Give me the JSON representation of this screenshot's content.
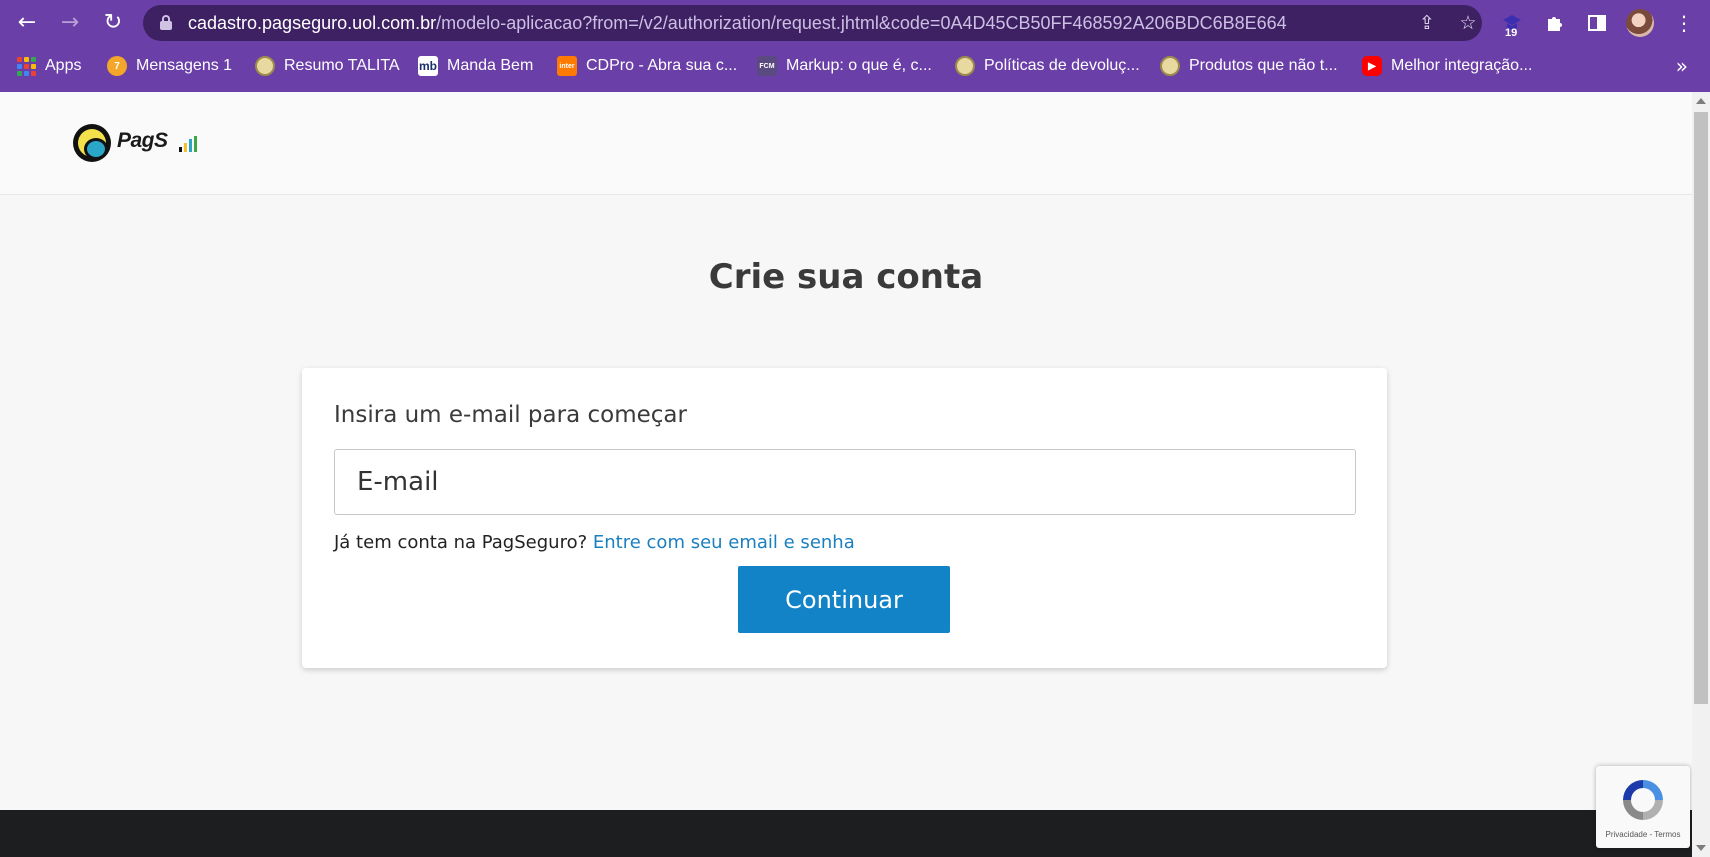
{
  "browser": {
    "url_host": "cadastro.pagseguro.uol.com.br",
    "url_path": "/modelo-aplicacao?from=/v2/authorization/request.jhtml&code=0A4D45CB50FF468592A206BDC6B8E664",
    "extension_badge": "19",
    "bookmarks": [
      {
        "label": "Apps",
        "icon": "apps-grid-icon"
      },
      {
        "label": "Mensagens 1",
        "icon": "message-icon",
        "icon_text": "7",
        "color": "#f4a62a"
      },
      {
        "label": "Resumo TALITA",
        "icon": "disk-icon",
        "color": "#e8d9a0"
      },
      {
        "label": "Manda Bem",
        "icon": "mb-icon",
        "icon_text": "mb",
        "color": "#1b2f6b"
      },
      {
        "label": "CDPro - Abra sua c...",
        "icon": "inter-icon",
        "icon_text": "inter",
        "color": "#ff7a00"
      },
      {
        "label": "Markup: o que é, c...",
        "icon": "markup-icon",
        "icon_text": "FCM",
        "color": "#4a3b6e"
      },
      {
        "label": "Políticas de devoluç...",
        "icon": "disk-icon",
        "color": "#e8d9a0"
      },
      {
        "label": "Produtos que não t...",
        "icon": "disk-icon",
        "color": "#e8d9a0"
      },
      {
        "label": "Melhor integração...",
        "icon": "youtube-icon",
        "color": "#ff0000"
      }
    ],
    "more_bookmarks": "»"
  },
  "page": {
    "logo_text": "PagSeguro",
    "title": "Crie sua conta",
    "form": {
      "label": "Insira um e-mail para começar",
      "email_placeholder": "E-mail",
      "email_value": "",
      "login_question": "Já tem conta na PagSeguro?",
      "login_link": "Entre com seu email e senha",
      "continue_label": "Continuar"
    },
    "recaptcha_text": "Privacidade - Termos"
  },
  "colors": {
    "chrome": "#6b3fa8",
    "omnibox": "#3d2163",
    "primary_button": "#1283c6",
    "link": "#1a7fbf",
    "footer": "#1d1e20"
  }
}
